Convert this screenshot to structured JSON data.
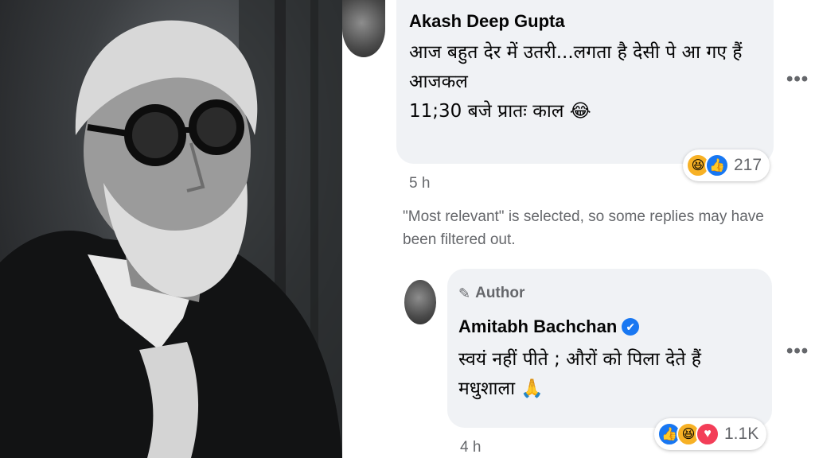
{
  "photo": {
    "alt_subject": "portrait-photo"
  },
  "comment": {
    "author": "Akash Deep Gupta",
    "line1": "आज बहुत देर में उतरी...लगता है देसी पे आ गए हैं",
    "line2": "आजकल",
    "line3": "11;30 बजे प्रातः काल 😂",
    "time": "5 h",
    "reaction_count": "217",
    "more": "•••"
  },
  "notice": {
    "line1": "\"Most relevant\" is selected, so some replies may have",
    "line2": "been filtered out."
  },
  "reply": {
    "badge": "Author",
    "author": "Amitabh Bachchan",
    "verified_mark": "✔",
    "line1": "स्वयं नहीं पीते ; औरों को पिला देते हैं",
    "line2": "मधुशाला 🙏",
    "time": "4 h",
    "reaction_count": "1.1K",
    "more": "•••"
  },
  "colors": {
    "bubble": "#f0f2f5",
    "meta_text": "#65676b",
    "like_blue": "#1877f2",
    "haha_yellow": "#f7b125",
    "love_red": "#f33e58"
  },
  "icons": [
    "haha-reaction-icon",
    "like-reaction-icon",
    "love-reaction-icon",
    "author-pen-icon",
    "verified-badge-icon",
    "more-options-icon"
  ]
}
